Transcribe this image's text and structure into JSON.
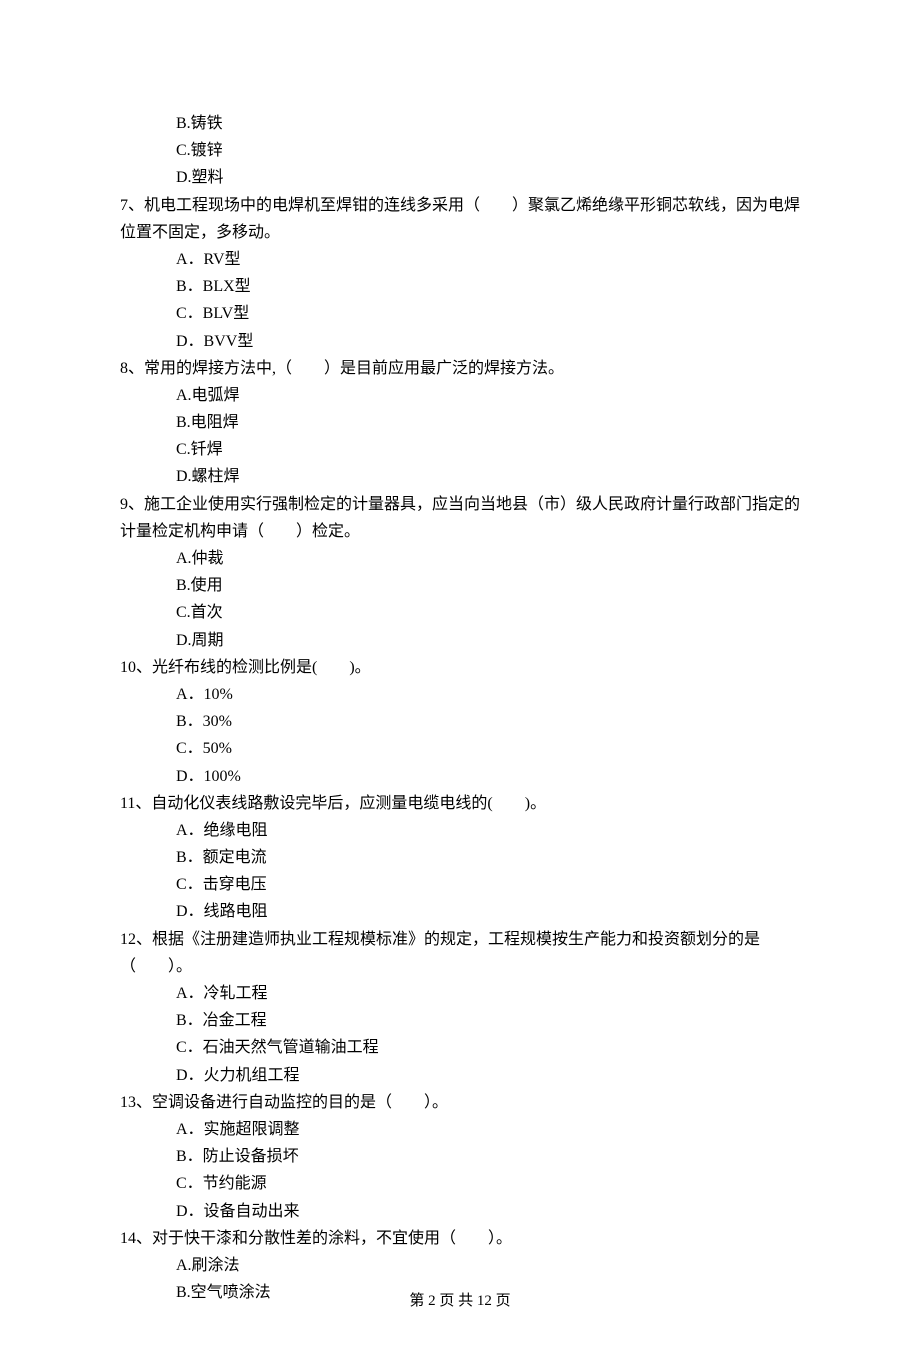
{
  "prev_options": {
    "b": "B.铸铁",
    "c": "C.镀锌",
    "d": "D.塑料"
  },
  "q7": {
    "stem": "7、机电工程现场中的电焊机至焊钳的连线多采用（　　）聚氯乙烯绝缘平形铜芯软线，因为电焊位置不固定，多移动。",
    "a": "A．RV型",
    "b": "B．BLX型",
    "c": "C．BLV型",
    "d": "D．BVV型"
  },
  "q8": {
    "stem": "8、常用的焊接方法中,（　　）是目前应用最广泛的焊接方法。",
    "a": "A.电弧焊",
    "b": "B.电阻焊",
    "c": "C.钎焊",
    "d": "D.螺柱焊"
  },
  "q9": {
    "stem": "9、施工企业使用实行强制检定的计量器具，应当向当地县（市）级人民政府计量行政部门指定的计量检定机构申请（　　）检定。",
    "a": "A.仲裁",
    "b": "B.使用",
    "c": "C.首次",
    "d": "D.周期"
  },
  "q10": {
    "stem": "10、光纤布线的检测比例是(　　)。",
    "a": "A．10%",
    "b": "B．30%",
    "c": "C．50%",
    "d": "D．100%"
  },
  "q11": {
    "stem": "11、自动化仪表线路敷设完毕后，应测量电缆电线的(　　)。",
    "a": "A．绝缘电阻",
    "b": "B．额定电流",
    "c": "C．击穿电压",
    "d": "D．线路电阻"
  },
  "q12": {
    "stem": "12、根据《注册建造师执业工程规模标准》的规定，工程规模按生产能力和投资额划分的是（　　）。",
    "a": "A．冷轧工程",
    "b": "B．冶金工程",
    "c": "C．石油天然气管道输油工程",
    "d": "D．火力机组工程"
  },
  "q13": {
    "stem": "13、空调设备进行自动监控的目的是（　　）。",
    "a": "A．实施超限调整",
    "b": "B．防止设备损坏",
    "c": "C．节约能源",
    "d": "D．设备自动出来"
  },
  "q14": {
    "stem": "14、对于快干漆和分散性差的涂料，不宜使用（　　）。",
    "a": "A.刷涂法",
    "b": "B.空气喷涂法"
  },
  "footer": "第 2 页 共 12 页"
}
